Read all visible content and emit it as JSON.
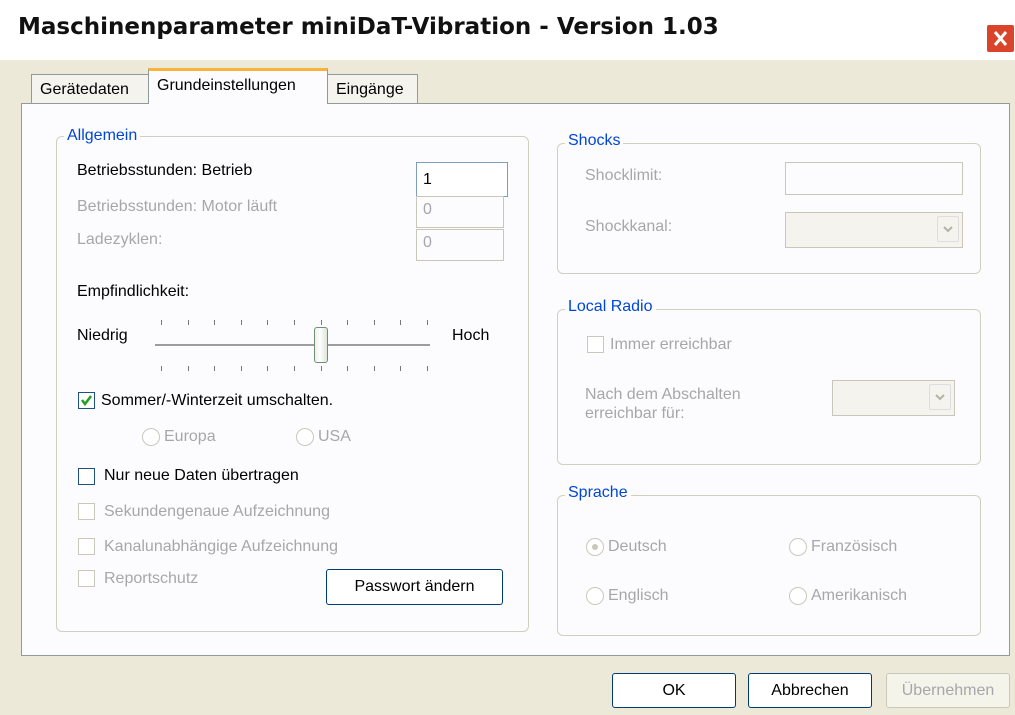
{
  "window": {
    "title": "Maschinenparameter miniDaT-Vibration - Version 1.03"
  },
  "tabs": [
    {
      "label": "Gerätedaten"
    },
    {
      "label": "Grundeinstellungen"
    },
    {
      "label": "Eingänge"
    }
  ],
  "allgemein": {
    "legend": "Allgemein",
    "betriebsstunden_betrieb": {
      "label": "Betriebsstunden: Betrieb",
      "value": "1"
    },
    "betriebsstunden_motor": {
      "label": "Betriebsstunden: Motor läuft",
      "value": "0"
    },
    "ladezyklen": {
      "label": "Ladezyklen:",
      "value": "0"
    },
    "empfindlichkeit": {
      "label": "Empfindlichkeit:",
      "low": "Niedrig",
      "high": "Hoch",
      "level_fraction": 0.6
    },
    "sommerzeit": {
      "label": "Sommer/-Winterzeit umschalten.",
      "checked": true
    },
    "europa": "Europa",
    "usa": "USA",
    "nur_neue": {
      "label": "Nur neue Daten übertragen",
      "checked": false
    },
    "sekundengenau": "Sekundengenaue Aufzeichnung",
    "kanalunabhaengig": "Kanalunabhängige Aufzeichnung",
    "reportschutz": "Reportschutz",
    "passwort_button": "Passwort ändern"
  },
  "shocks": {
    "legend": "Shocks",
    "shocklimit": "Shocklimit:",
    "shockkanal": "Shockkanal:"
  },
  "local_radio": {
    "legend": "Local Radio",
    "immer": "Immer erreichbar",
    "nach_line1": "Nach dem Abschalten",
    "nach_line2": "erreichbar für:"
  },
  "sprache": {
    "legend": "Sprache",
    "deutsch": "Deutsch",
    "franzoesisch": "Französisch",
    "englisch": "Englisch",
    "amerikanisch": "Amerikanisch",
    "selected": "Deutsch"
  },
  "buttons": {
    "ok": "OK",
    "cancel": "Abbrechen",
    "apply": "Übernehmen"
  },
  "colors": {
    "accent": "#0046d5",
    "close": "#d9442a",
    "tab_highlight": "#f8b43a"
  }
}
